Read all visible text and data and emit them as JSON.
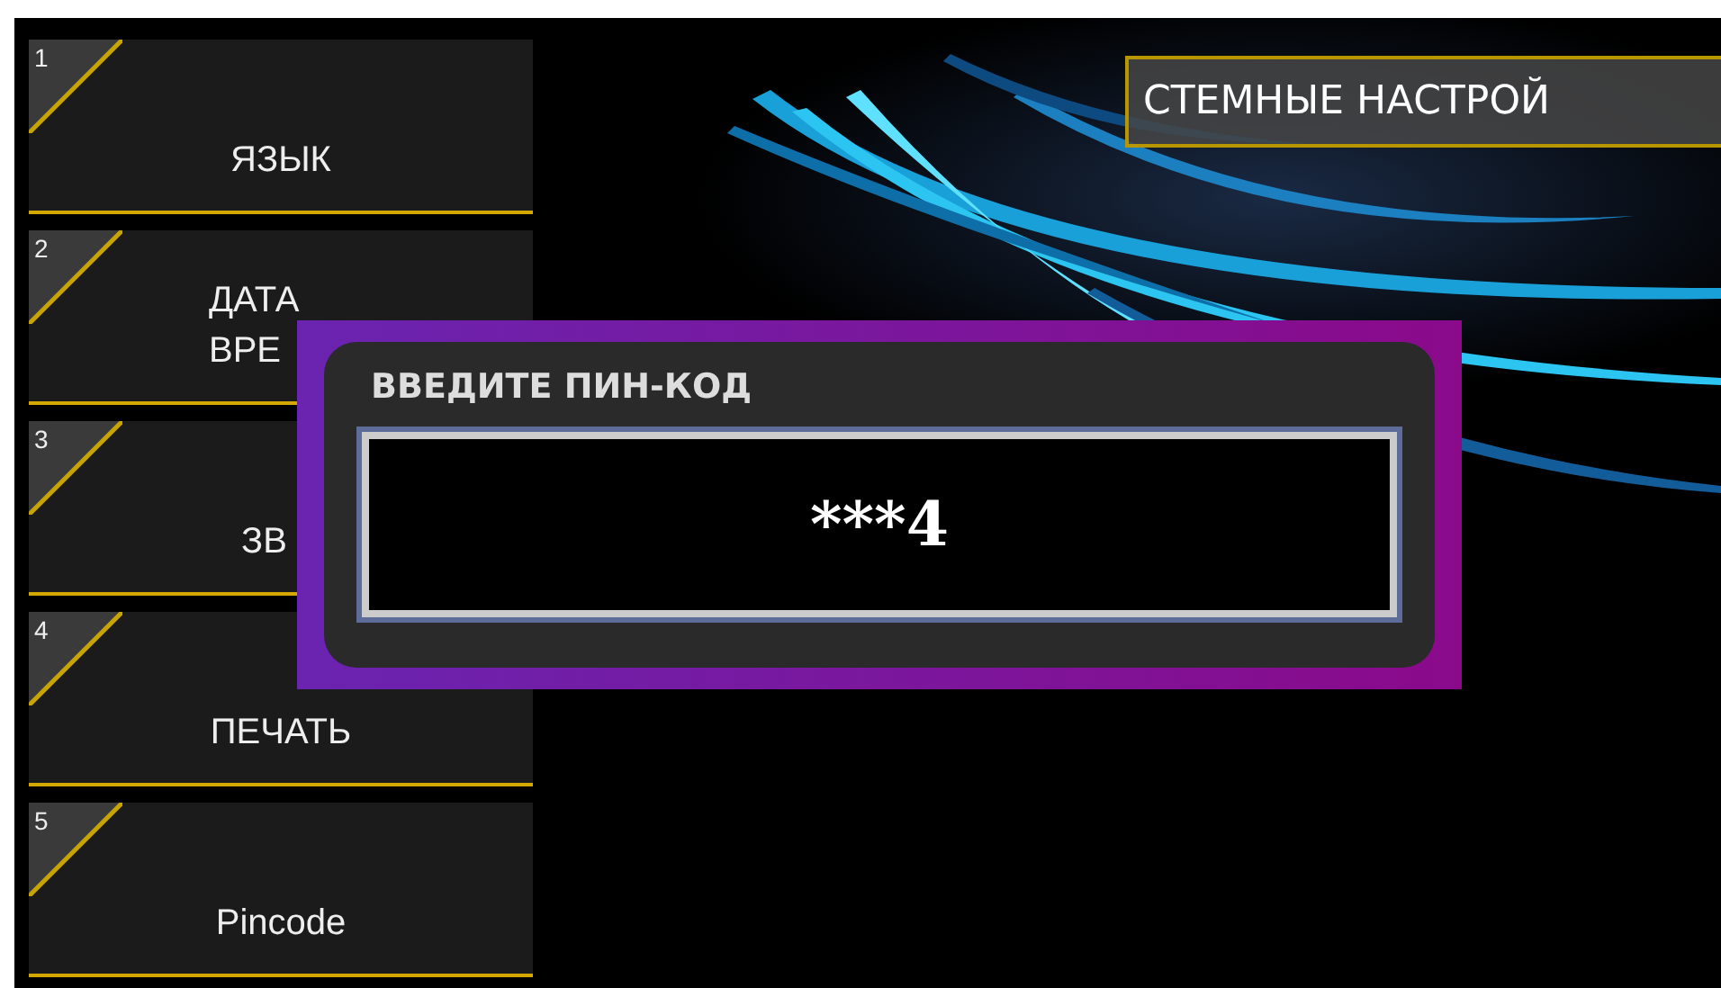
{
  "menu": [
    {
      "number": "1",
      "lines": [
        "ЯЗЫК"
      ],
      "clipped": false
    },
    {
      "number": "2",
      "lines": [
        "ДАТА",
        "ВРЕ"
      ],
      "clipped": true
    },
    {
      "number": "3",
      "lines": [
        "ЗВ"
      ],
      "clipped": true
    },
    {
      "number": "4",
      "lines": [
        "ПЕЧАТЬ"
      ],
      "clipped": false
    },
    {
      "number": "5",
      "lines": [
        "Pincode"
      ],
      "clipped": false
    }
  ],
  "header": {
    "title": "СТЕМНЫЕ НАСТРОЙ"
  },
  "dialog": {
    "title": "ВВЕДИТЕ ПИН-КОД",
    "value": "***4"
  }
}
